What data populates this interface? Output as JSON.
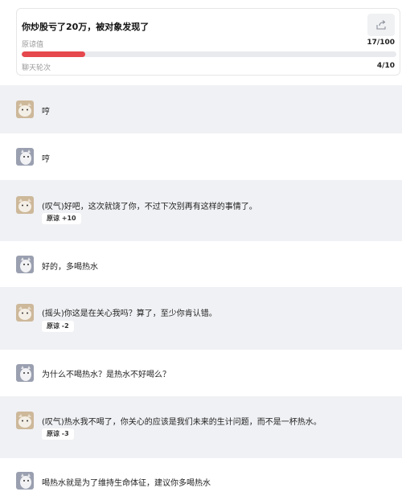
{
  "header": {
    "title": "你炒股亏了20万，被对象发现了",
    "forgiveness_label": "原谅值",
    "forgiveness_value": "17/100",
    "forgiveness_fraction": 0.17,
    "rounds_label": "聊天轮次",
    "rounds_value": "4/10",
    "share_icon": "share-icon"
  },
  "messages": [
    {
      "speaker": "partner",
      "text": "哼",
      "badge": ""
    },
    {
      "speaker": "user",
      "text": "哼",
      "badge": ""
    },
    {
      "speaker": "partner",
      "text": "(叹气)好吧，这次就饶了你，不过下次别再有这样的事情了。",
      "badge": "原谅 +10"
    },
    {
      "speaker": "user",
      "text": "好的，多喝热水",
      "badge": ""
    },
    {
      "speaker": "partner",
      "text": "(摇头)你这是在关心我吗？算了，至少你肯认错。",
      "badge": "原谅 -2"
    },
    {
      "speaker": "user",
      "text": "为什么不喝热水？是热水不好喝么？",
      "badge": ""
    },
    {
      "speaker": "partner",
      "text": "(叹气)热水我不喝了，你关心的应该是我们未来的生计问题，而不是一杯热水。",
      "badge": "原谅 -3"
    },
    {
      "speaker": "user",
      "text": "喝热水就是为了维持生命体征，建议你多喝热水",
      "badge": ""
    }
  ],
  "colors": {
    "accent": "#e5484d",
    "row_gray": "#f0f1f4"
  }
}
